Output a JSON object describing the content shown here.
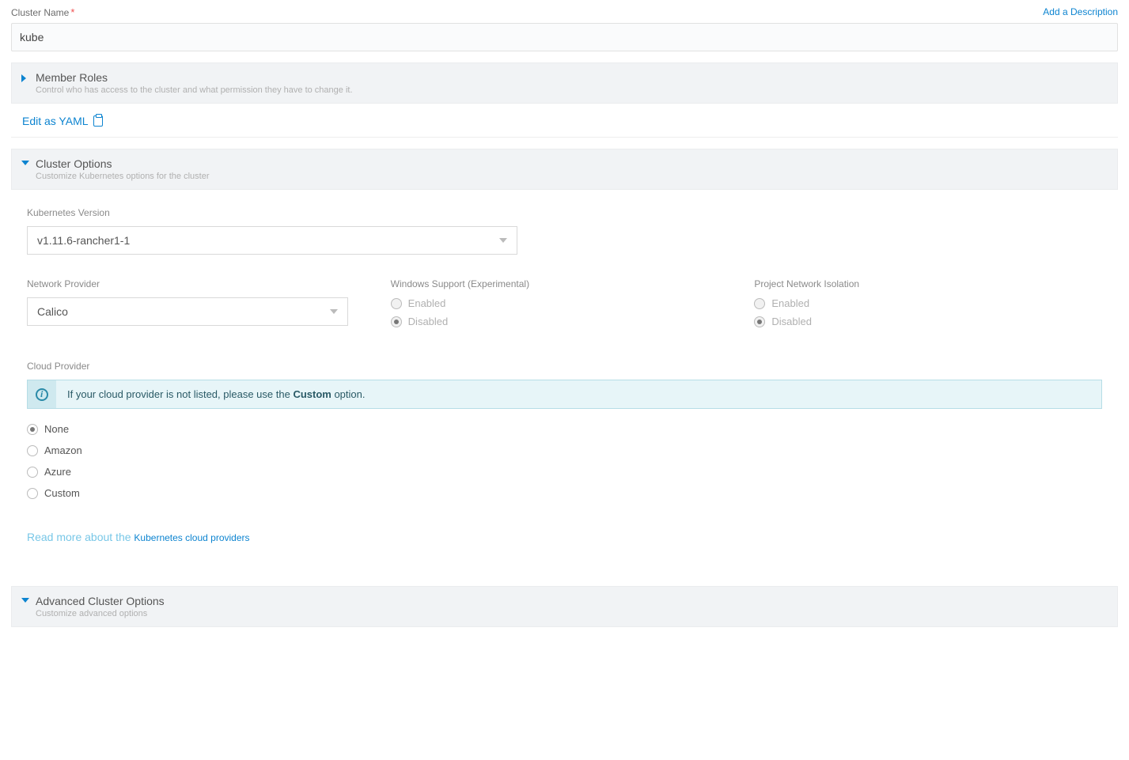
{
  "clusterName": {
    "label": "Cluster Name",
    "value": "kube"
  },
  "addDescription": "Add a Description",
  "memberRoles": {
    "title": "Member Roles",
    "sub": "Control who has access to the cluster and what permission they have to change it."
  },
  "yaml": {
    "label": "Edit as YAML"
  },
  "clusterOptions": {
    "title": "Cluster Options",
    "sub": "Customize Kubernetes options for the cluster"
  },
  "k8sVersion": {
    "label": "Kubernetes Version",
    "value": "v1.11.6-rancher1-1"
  },
  "networkProvider": {
    "label": "Network Provider",
    "value": "Calico"
  },
  "windowsSupport": {
    "label": "Windows Support (Experimental)",
    "enabled": "Enabled",
    "disabled": "Disabled"
  },
  "projectIsolation": {
    "label": "Project Network Isolation",
    "enabled": "Enabled",
    "disabled": "Disabled"
  },
  "cloudProvider": {
    "label": "Cloud Provider",
    "info_pre": "If your cloud provider is not listed, please use the ",
    "info_bold": "Custom",
    "info_post": " option.",
    "options": {
      "none": "None",
      "amazon": "Amazon",
      "azure": "Azure",
      "custom": "Custom"
    },
    "readmore_pre": "Read more about the ",
    "readmore_link": "Kubernetes cloud providers"
  },
  "advanced": {
    "title": "Advanced Cluster Options",
    "sub": "Customize advanced options"
  }
}
